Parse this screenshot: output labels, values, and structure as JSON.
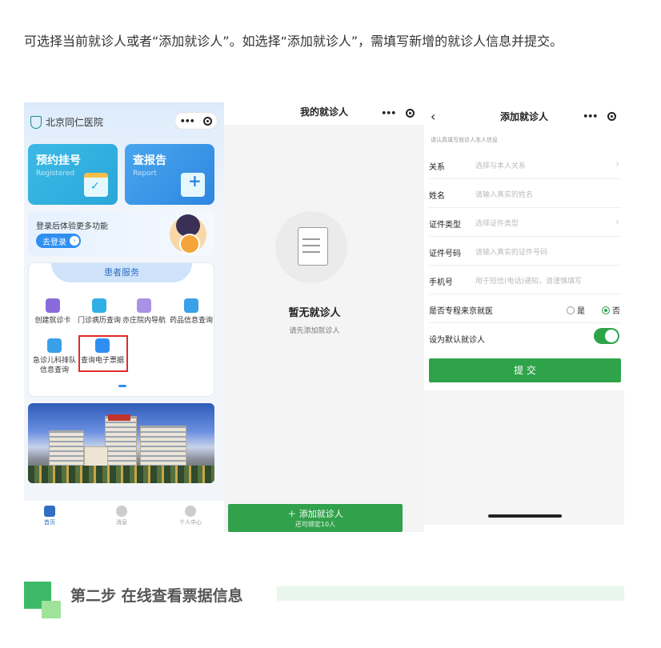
{
  "intro_text": "可选择当前就诊人或者“添加就诊人”。如选择“添加就诊人”，需填写新增的就诊人信息并提交。",
  "panel_home": {
    "hospital_name": "北京同仁医院",
    "capsule": {
      "more": "•••",
      "record": "◎"
    },
    "card_register": {
      "title": "预约挂号",
      "subtitle": "Registered"
    },
    "card_report": {
      "title": "查报告",
      "subtitle": "Report"
    },
    "login_banner": {
      "text": "登录后体验更多功能",
      "button": "去登录",
      "arrow": "›"
    },
    "services_title": "患者服务",
    "services": [
      {
        "label": "创建就诊卡",
        "icon": "wallet-icon",
        "color": "#8b6bdc"
      },
      {
        "label": "门诊病历查询",
        "icon": "record-icon",
        "color": "#31b0e8"
      },
      {
        "label": "亦庄院内导航",
        "icon": "navigation-icon",
        "color": "#a991e6"
      },
      {
        "label": "药品信息查询",
        "icon": "medicine-icon",
        "color": "#3aa0e8"
      },
      {
        "label": "急诊儿科排队信息查询",
        "label_line1": "急诊儿科排队",
        "label_line2": "信息查询",
        "icon": "clock-icon",
        "color": "#3aa0e8"
      },
      {
        "label": "查询电子票据",
        "icon": "receipt-icon",
        "color": "#2f8ff0"
      }
    ],
    "tabs": [
      {
        "label": "首页",
        "active": true
      },
      {
        "label": "消息",
        "active": false
      },
      {
        "label": "个人中心",
        "active": false
      }
    ]
  },
  "panel_patients": {
    "title": "我的就诊人",
    "capsule": {
      "more": "•••",
      "record": "◎"
    },
    "empty_title": "暂无就诊人",
    "empty_subtitle": "请先添加就诊人",
    "add_button": "＋ 添加就诊人",
    "add_hint": "还可绑定10人"
  },
  "panel_add": {
    "back": "‹",
    "title": "添加就诊人",
    "capsule": {
      "more": "•••",
      "record": "◎"
    },
    "hint": "请认真填写就诊人本人信息",
    "fields": [
      {
        "label": "关系",
        "placeholder": "选择与本人关系",
        "arrow": "›"
      },
      {
        "label": "姓名",
        "placeholder": "请输入真实的姓名",
        "arrow": ""
      },
      {
        "label": "证件类型",
        "placeholder": "选择证件类型",
        "arrow": "›"
      },
      {
        "label": "证件号码",
        "placeholder": "请输入真实的证件号码",
        "arrow": ""
      },
      {
        "label": "手机号",
        "placeholder": "用于短信(电话)通知，请谨慎填写",
        "arrow": ""
      }
    ],
    "beijing_question": "是否专程来京就医",
    "option_yes": "是",
    "option_no": "否",
    "selected_option": "否",
    "default_label": "设为默认就诊人",
    "default_on": true,
    "submit": "提 交"
  },
  "step_heading": "第二步  在线查看票据信息",
  "colors": {
    "green": "#2fa34a",
    "blue": "#2f8ff0",
    "highlight": "#e02b2b"
  }
}
